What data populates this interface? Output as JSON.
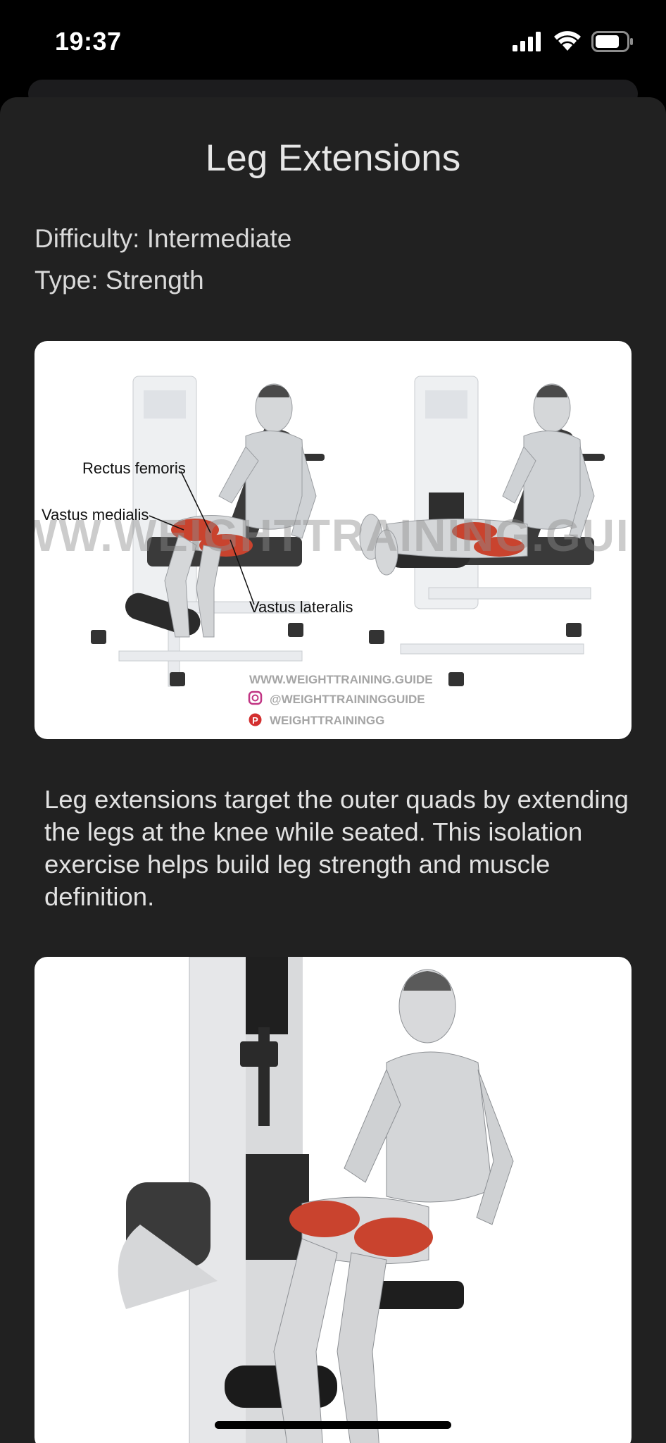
{
  "status_bar": {
    "time": "19:37"
  },
  "exercise": {
    "title": "Leg Extensions",
    "difficulty": "Difficulty: Intermediate",
    "type": "Type: Strength",
    "description": "Leg extensions target the outer quads by extending the legs at the knee while seated. This isolation exercise helps build leg strength and muscle definition."
  },
  "illustration": {
    "labels": {
      "rectus": "Rectus femoris",
      "medialis": "Vastus medialis",
      "lateralis": "Vastus lateralis"
    },
    "watermark": "WWW.WEIGHTTRAINING.GUIDE",
    "site": "WWW.WEIGHTTRAINING.GUIDE",
    "instagram": "@WEIGHTTRAININGGUIDE",
    "pinterest": "WEIGHTTRAININGG"
  },
  "colors": {
    "sheet_background": "#212121",
    "muscle_highlight": "#c9432e"
  }
}
